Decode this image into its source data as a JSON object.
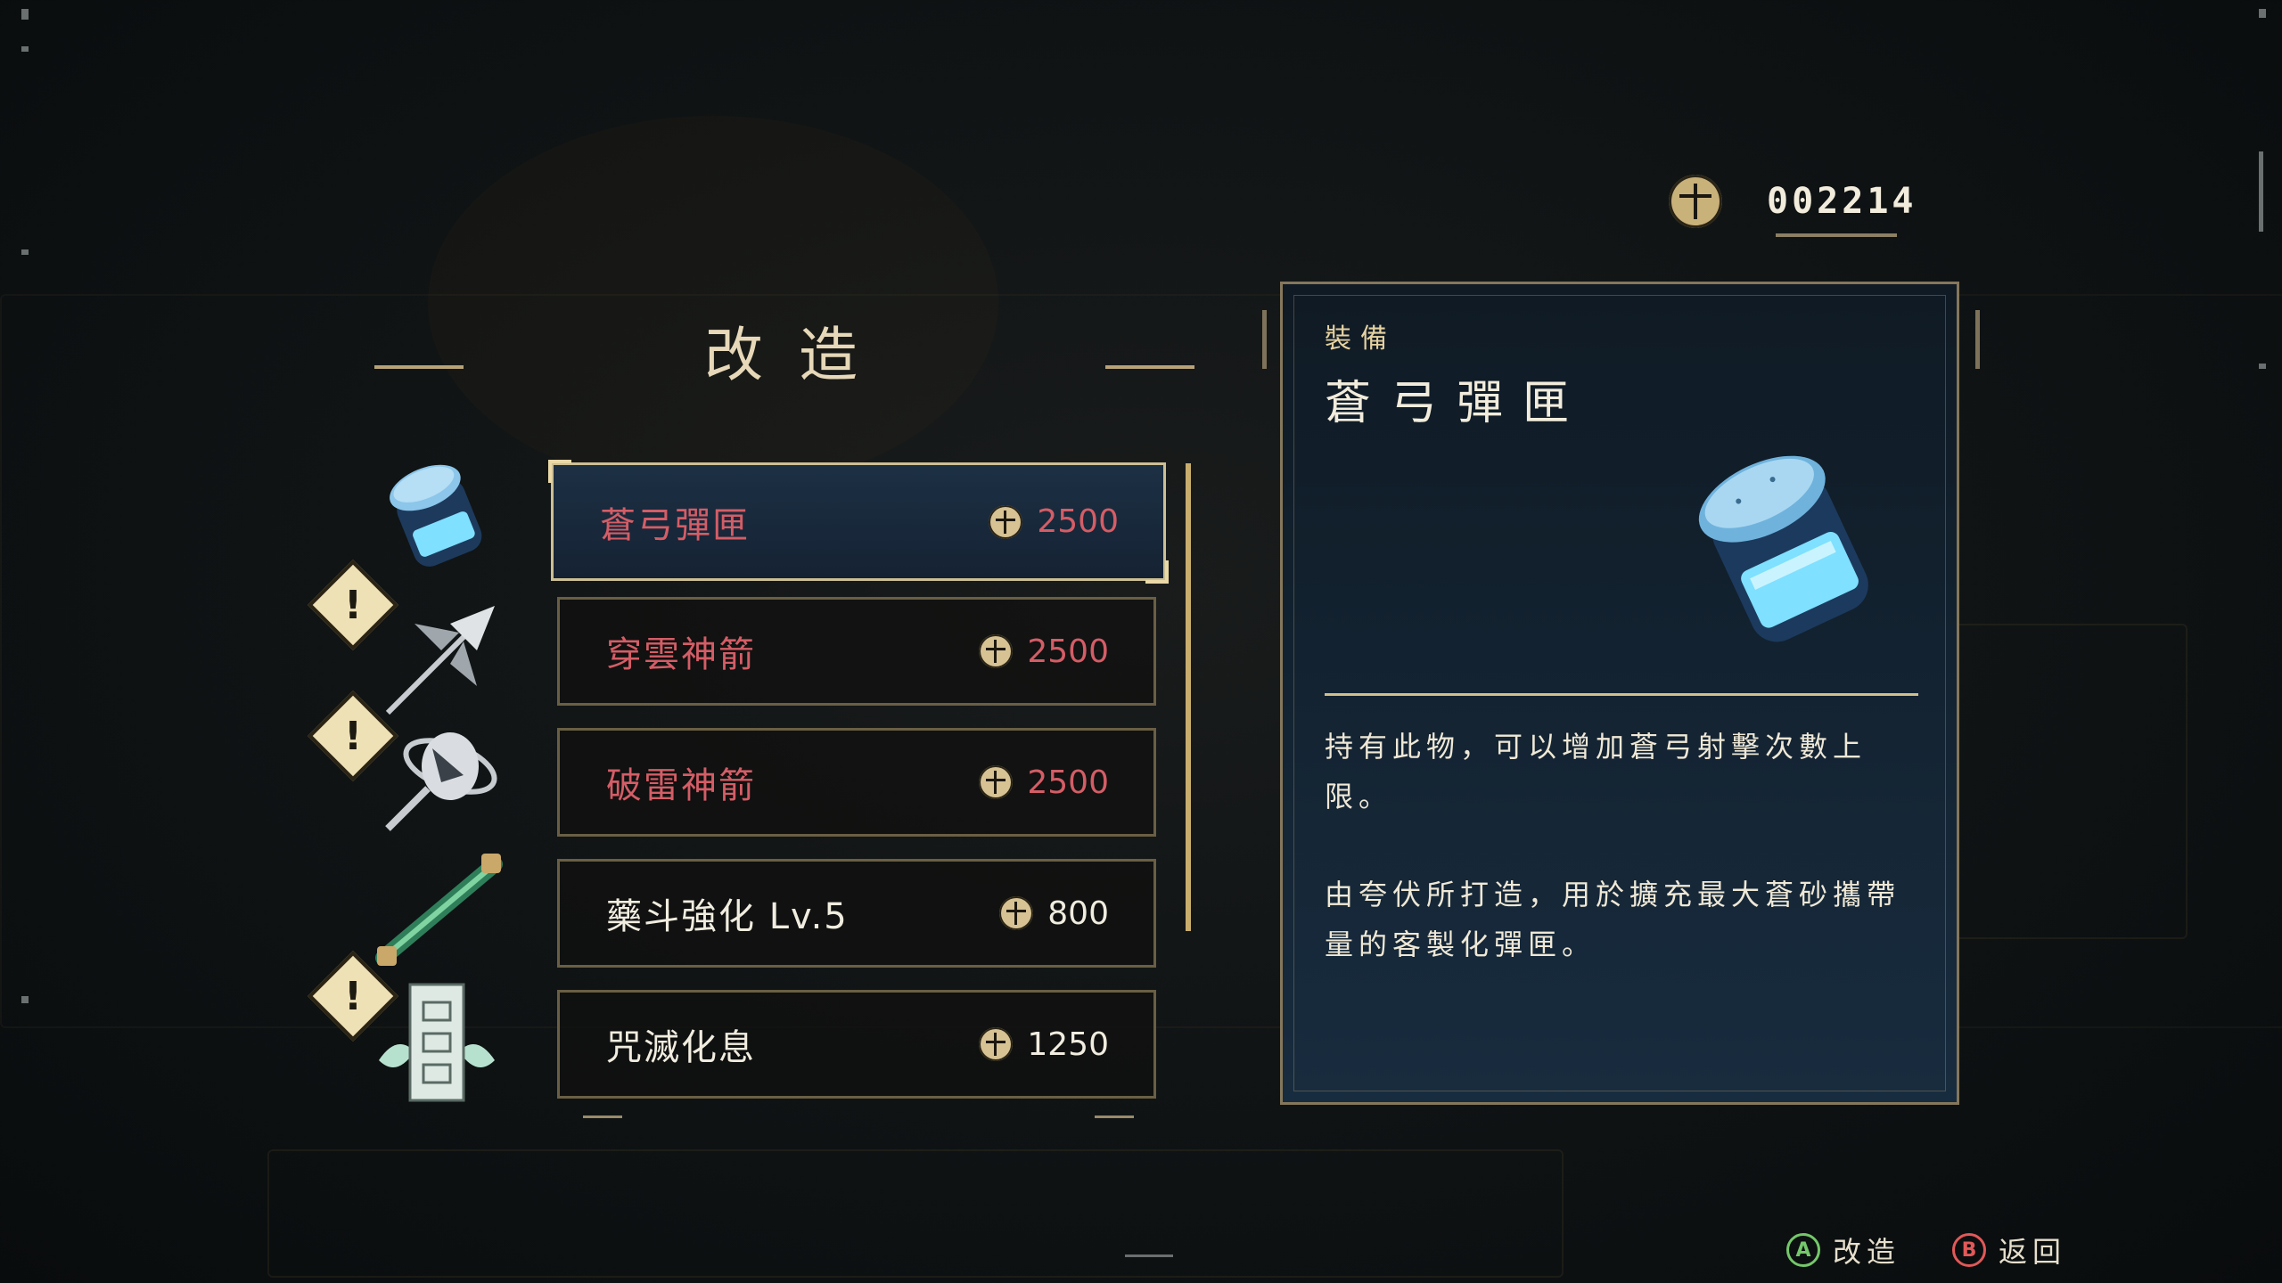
{
  "currency": {
    "amount": "002214",
    "icon": "coin-icon"
  },
  "menu": {
    "title": "改造"
  },
  "items": [
    {
      "name": "蒼弓彈匣",
      "price": "2500",
      "state": "selected",
      "name_color": "#d45d66",
      "icon": "blue-canister-icon",
      "warning": false
    },
    {
      "name": "穿雲神箭",
      "price": "2500",
      "state": "locked",
      "name_color": "#d45d66",
      "icon": "piercing-arrow-icon",
      "warning": true
    },
    {
      "name": "破雷神箭",
      "price": "2500",
      "state": "locked",
      "name_color": "#d45d66",
      "icon": "thunder-arrow-icon",
      "warning": true
    },
    {
      "name": "藥斗強化 Lv.5",
      "price": "800",
      "state": "available",
      "name_color": "#f0ecdf",
      "icon": "medicine-pipe-icon",
      "warning": false
    },
    {
      "name": "咒滅化息",
      "price": "1250",
      "state": "available",
      "name_color": "#f0ecdf",
      "icon": "talisman-icon",
      "warning": true
    }
  ],
  "detail": {
    "category": "裝備",
    "title": "蒼弓彈匣",
    "description_1": "持有此物，可以增加蒼弓射擊次數上限。",
    "description_2": "由夸伏所打造，用於擴充最大蒼砂攜帶量的客製化彈匣。",
    "icon": "blue-canister-icon"
  },
  "hints": [
    {
      "button": "A",
      "label": "改造",
      "color": "#74c76a"
    },
    {
      "button": "B",
      "label": "返回",
      "color": "#e25858"
    }
  ]
}
